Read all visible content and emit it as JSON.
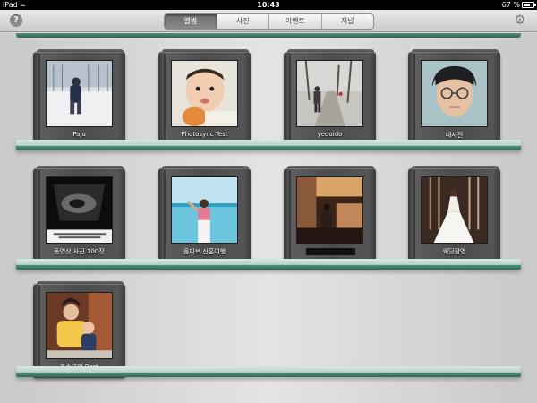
{
  "status_bar": {
    "carrier": "iPad",
    "wifi_icon": "wifi-icon",
    "time": "10:43",
    "battery_percent": "67 %",
    "battery_level": 0.67
  },
  "toolbar": {
    "help_label": "?",
    "settings_icon": "gear-icon",
    "tabs": [
      {
        "label": "앨범",
        "active": true
      },
      {
        "label": "사진",
        "active": false
      },
      {
        "label": "이벤트",
        "active": false
      },
      {
        "label": "저널",
        "active": false
      }
    ]
  },
  "shelf": {
    "rail_color": "#2f6656",
    "albums": [
      {
        "title": "Paju",
        "photo": "snow-field-child"
      },
      {
        "title": "Photosync Test",
        "photo": "baby-portrait"
      },
      {
        "title": "yeouido",
        "photo": "park-path"
      },
      {
        "title": "내사진",
        "photo": "man-with-glasses"
      },
      {
        "title": "동영상 사진 100장",
        "photo": "ultrasound"
      },
      {
        "title": "몰디브 신혼여행",
        "photo": "beach-woman"
      },
      {
        "title": "",
        "photo": "restaurant-interior",
        "redacted": true
      },
      {
        "title": "웨딩촬영",
        "photo": "bride-dress"
      },
      {
        "title": "호주여행 Best",
        "photo": "mother-and-child"
      }
    ]
  }
}
